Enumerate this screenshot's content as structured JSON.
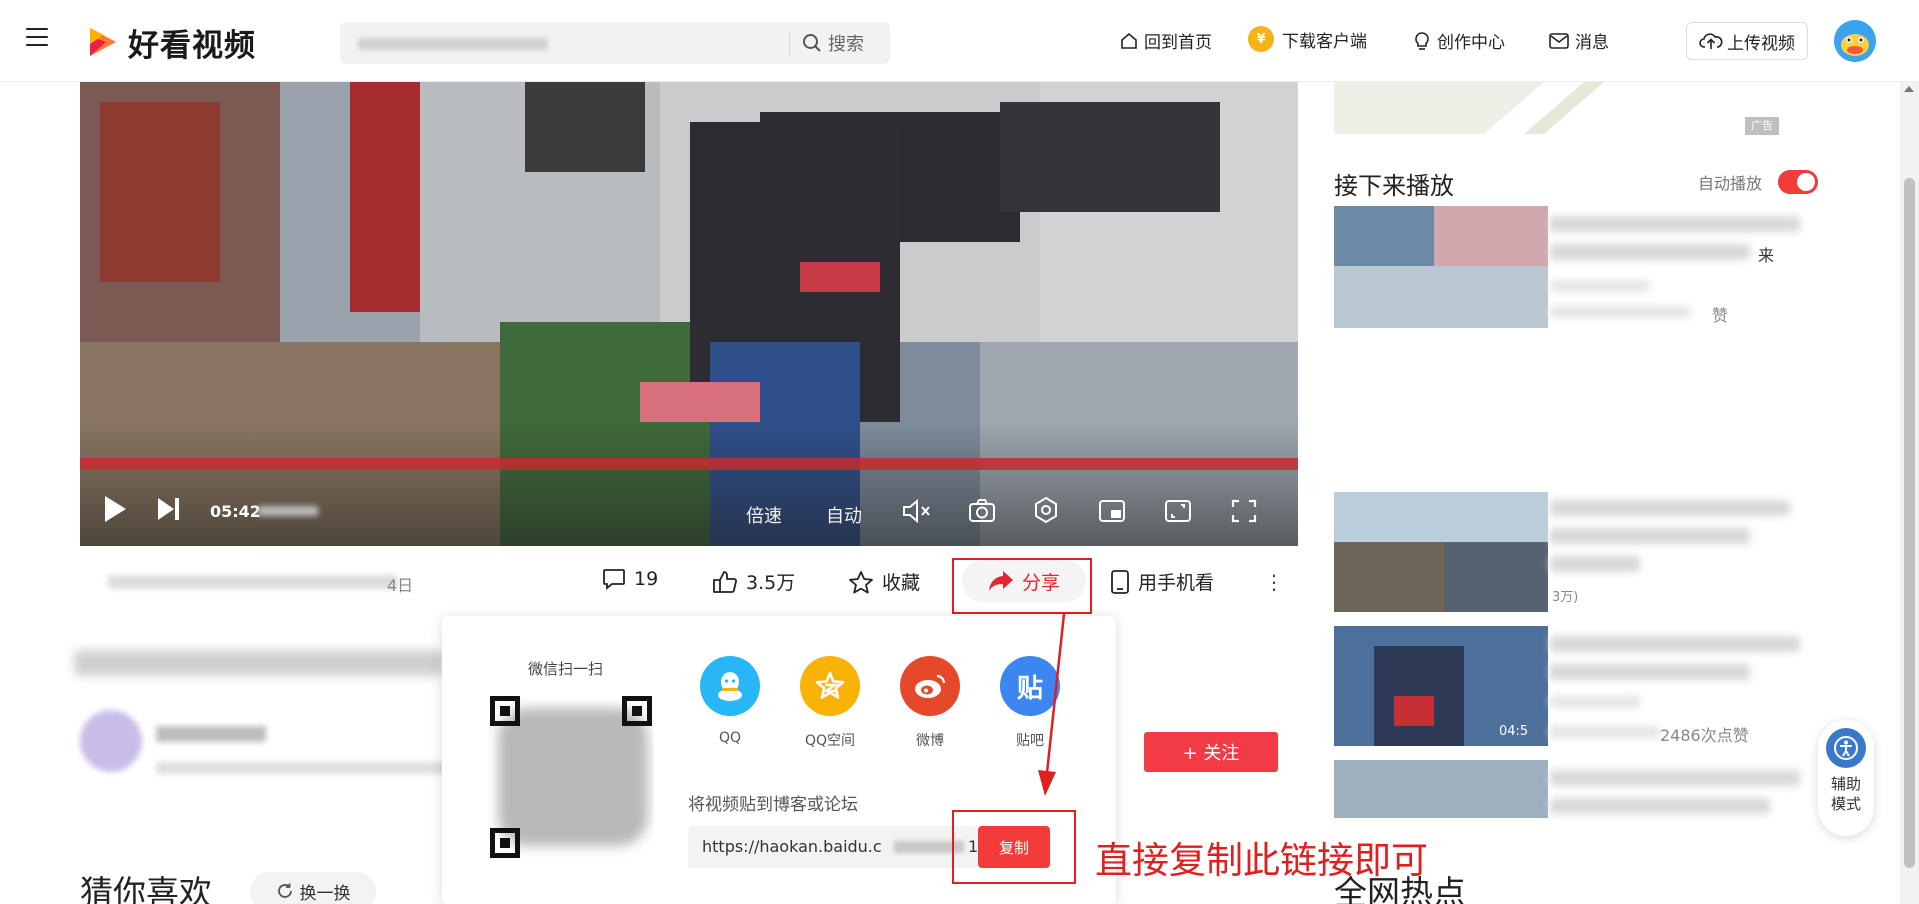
{
  "header": {
    "logo_text": "好看视频",
    "search_button": "搜索",
    "nav": {
      "home": "回到首页",
      "download": "下载客户端",
      "creator": "创作中心",
      "messages": "消息"
    },
    "coin_glyph": "¥",
    "upload": "上传视频"
  },
  "player": {
    "current_time": "05:42",
    "speed_label": "倍速",
    "auto_label": "自动"
  },
  "actions": {
    "date_suffix": "4日",
    "comments": "19",
    "likes": "3.5万",
    "favorite": "收藏",
    "share": "分享",
    "phone_watch": "用手机看",
    "more": "⋮"
  },
  "share_popup": {
    "scan_title": "微信扫一扫",
    "targets": [
      {
        "label": "QQ",
        "color": "#29b6f6"
      },
      {
        "label": "QQ空间",
        "color": "#f9b208"
      },
      {
        "label": "微博",
        "color": "#e5492a"
      },
      {
        "label": "贴吧",
        "color": "#3b86f0"
      }
    ],
    "tieba_glyph": "贴",
    "post_title": "将视频贴到博客或论坛",
    "link_text": "https://haokan.baidu.c",
    "link_tail": "1",
    "copy_button": "复制"
  },
  "annotation": "直接复制此链接即可",
  "author": {
    "follow_button": "+ 关注"
  },
  "guess": {
    "title": "猜你喜欢",
    "swap_button": "换一换"
  },
  "sidebar": {
    "ad_tag": "广告",
    "next_title": "接下来播放",
    "autoplay_label": "自动播放",
    "rec_fragments": [
      "来",
      "赞",
      "3万)",
      "04:5",
      "2486次点赞"
    ],
    "hot_title": "全网热点"
  },
  "assist": {
    "line1": "辅助",
    "line2": "模式"
  },
  "colors": {
    "accent": "#f23b3b",
    "annotation": "#e02020"
  }
}
